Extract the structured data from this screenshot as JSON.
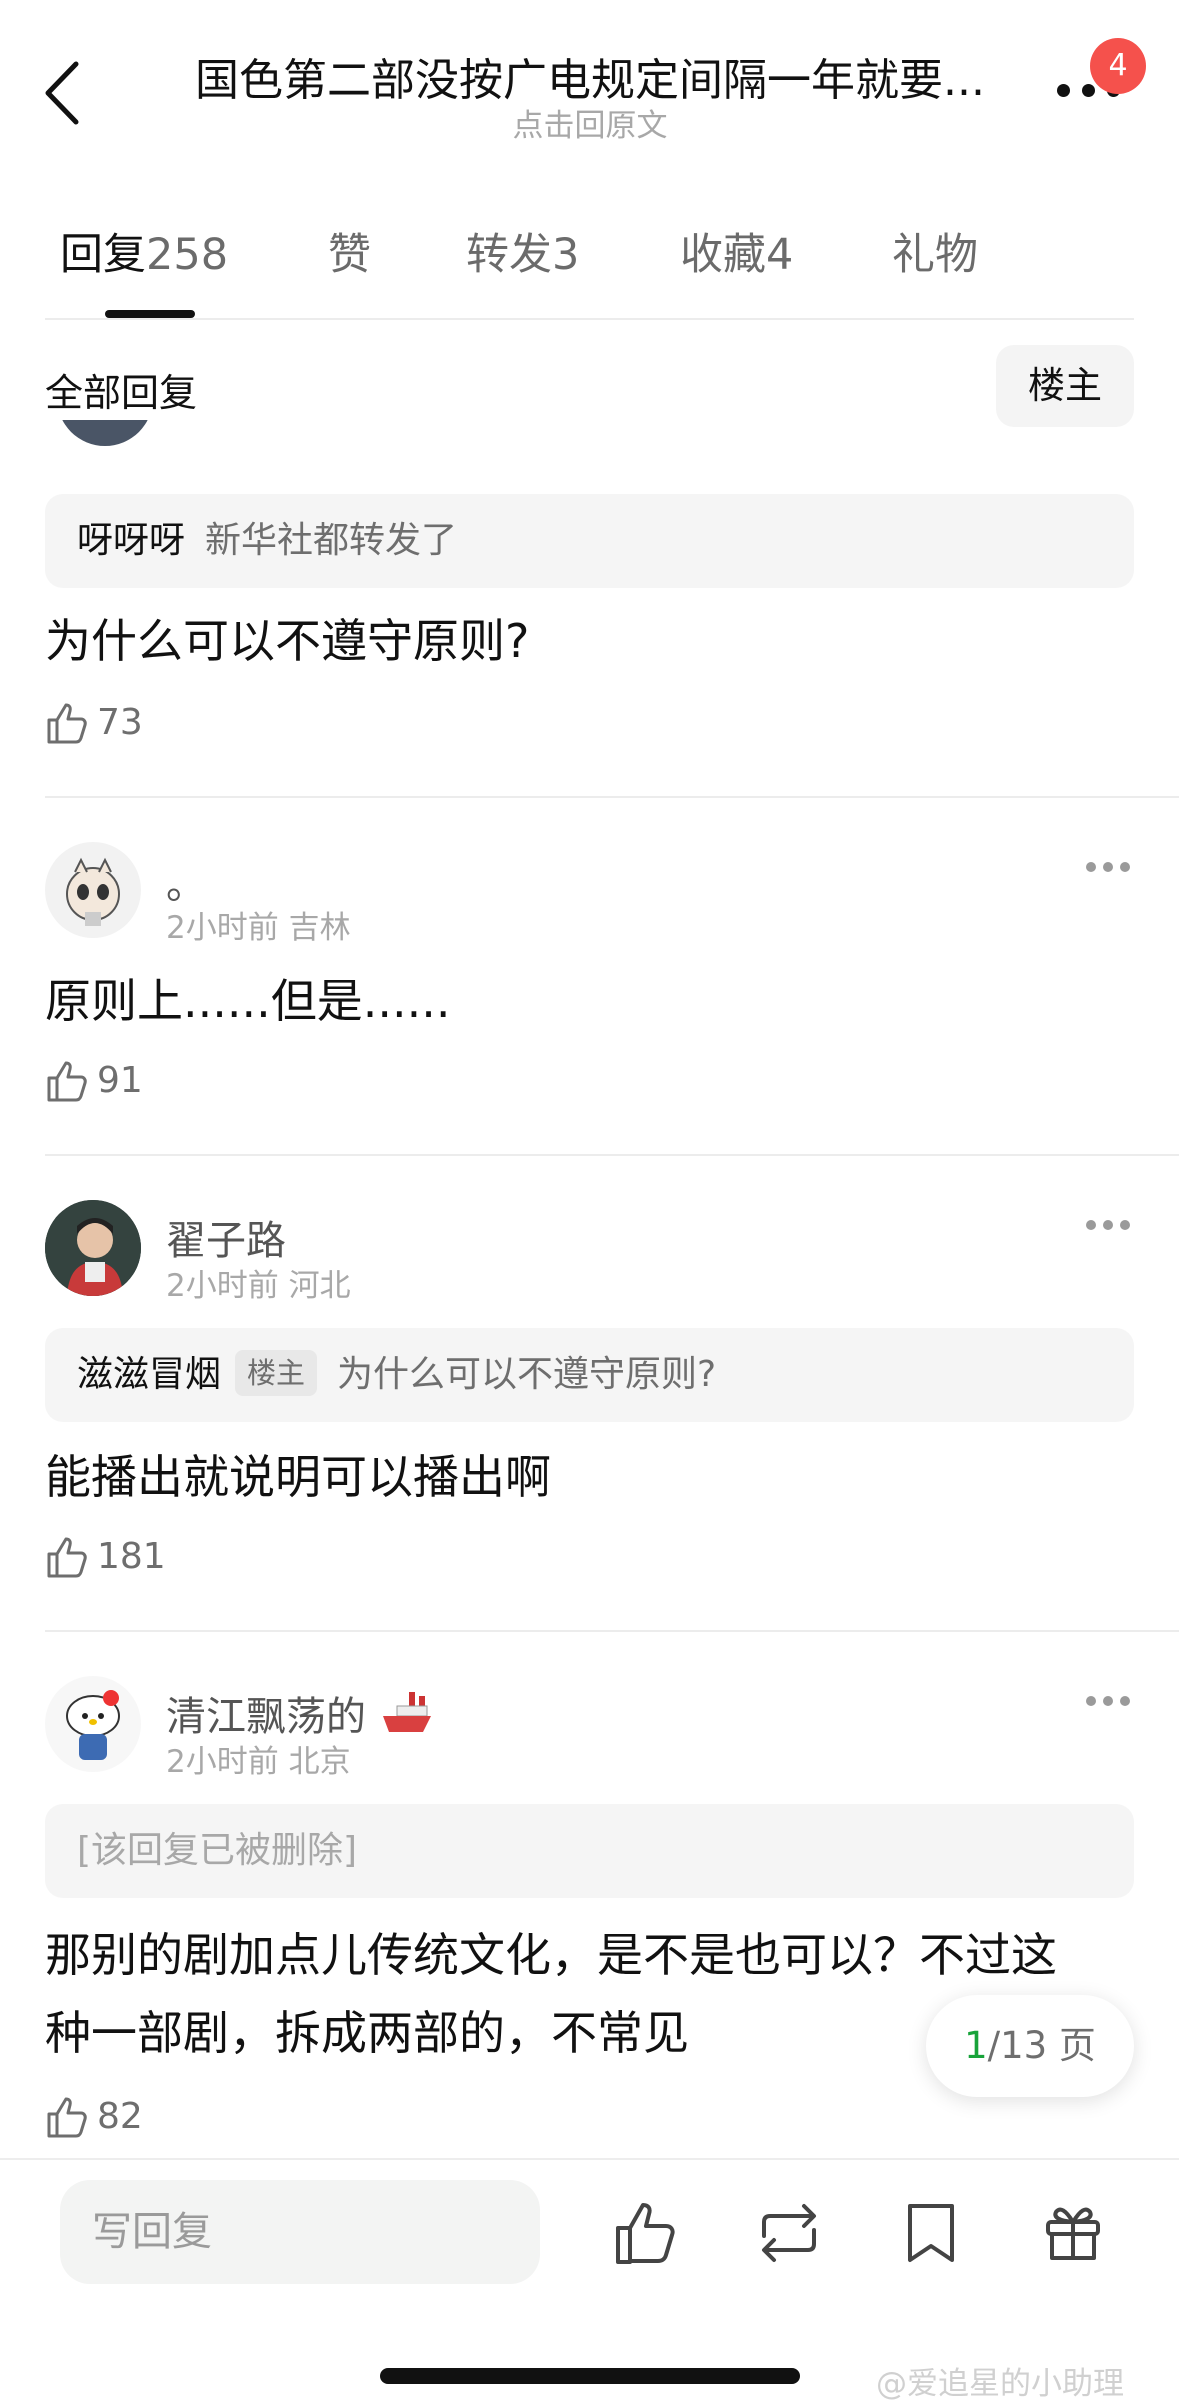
{
  "header": {
    "title": "国色第二部没按广电规定间隔一年就要...",
    "subtitle": "点击回原文",
    "notification_count": "4"
  },
  "tabs": [
    {
      "label": "回复",
      "count": "258"
    },
    {
      "label": "赞",
      "count": ""
    },
    {
      "label": "转发",
      "count": "3"
    },
    {
      "label": "收藏",
      "count": "4"
    },
    {
      "label": "礼物",
      "count": ""
    }
  ],
  "filter": {
    "title": "全部回复",
    "owner_label": "楼主"
  },
  "comments": [
    {
      "quote_name": "呀呀呀",
      "quote_text": "新华社都转发了",
      "text": "为什么可以不遵守原则?",
      "likes": "73"
    },
    {
      "name": "。",
      "meta": "2小时前 吉林",
      "text": "原则上......但是......",
      "likes": "91"
    },
    {
      "name": "翟子路",
      "meta": "2小时前 河北",
      "quote_name": "滋滋冒烟",
      "quote_tag": "楼主",
      "quote_text": "为什么可以不遵守原则?",
      "text": "能播出就说明可以播出啊",
      "likes": "181"
    },
    {
      "name": "清江飘荡的",
      "meta": "2小时前 北京",
      "quote_text": "[该回复已被删除]",
      "text_line1": "那别的剧加点儿传统文化，是不是也可以？不过这",
      "text_line2": "种一部剧，拆成两部的，不常见",
      "likes": "82"
    }
  ],
  "pager": {
    "current": "1",
    "total_text": "/13 页"
  },
  "bottom_bar": {
    "reply_placeholder": "写回复",
    "icons": [
      "like-icon",
      "repost-icon",
      "bookmark-icon",
      "gift-icon"
    ]
  },
  "watermark": "@爱追星的小助理",
  "colors": {
    "badge": "#f5514c",
    "pager_current": "#18a33a"
  }
}
